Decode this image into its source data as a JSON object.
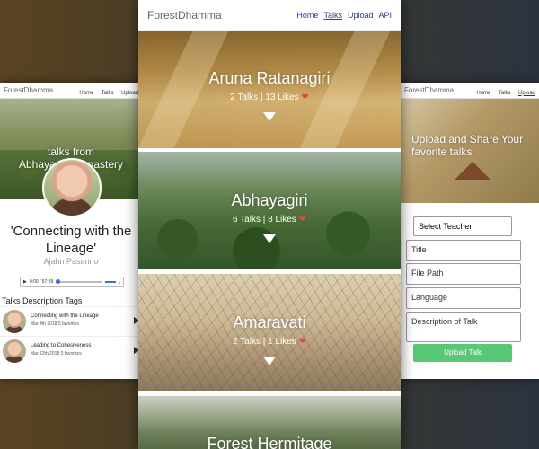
{
  "left": {
    "nav": {
      "brand": "ForestDhamma",
      "links": [
        "Home",
        "Talks",
        "Upload"
      ]
    },
    "hero_line1": "talks from",
    "hero_line2": "Abhayagiri Monastery",
    "talk_title": "'Connecting with the Lineage'",
    "teacher": "Ajahn Pasanno",
    "player_time": "0:00 / 57:28",
    "section_label": "Talks Description Tags",
    "talks": [
      {
        "title": "Connecting with the Lineage",
        "meta": "Mar 4th 2018 5 favorites"
      },
      {
        "title": "Leading to Cohesiveness",
        "meta": "Mar 12th 2018 0 favorites"
      }
    ]
  },
  "center": {
    "nav": {
      "brand": "ForestDhamma",
      "links": [
        "Home",
        "Talks",
        "Upload",
        "API"
      ],
      "active": "Talks"
    },
    "monasteries": [
      {
        "name": "Aruna Ratanagiri",
        "talks": "2 Talks",
        "likes": "13 Likes"
      },
      {
        "name": "Abhayagiri",
        "talks": "6 Talks",
        "likes": "8 Likes"
      },
      {
        "name": "Amaravati",
        "talks": "2 Talks",
        "likes": "1 Likes"
      },
      {
        "name": "Forest Hermitage"
      }
    ]
  },
  "right": {
    "nav": {
      "brand": "ForestDhamma",
      "links": [
        "Home",
        "Talks",
        "Upload"
      ],
      "active": "Upload"
    },
    "hero_text": "Upload and Share Your favorite talks",
    "select_teacher": "Select Teacher",
    "fields": {
      "title": "Title",
      "file_path": "File Path",
      "language": "Language",
      "description": "Description of Talk"
    },
    "upload_button": "Upload Talk"
  },
  "colors": {
    "heart": "#e04848",
    "upload_button": "#58c876",
    "nav_link": "#2a3a9a"
  }
}
